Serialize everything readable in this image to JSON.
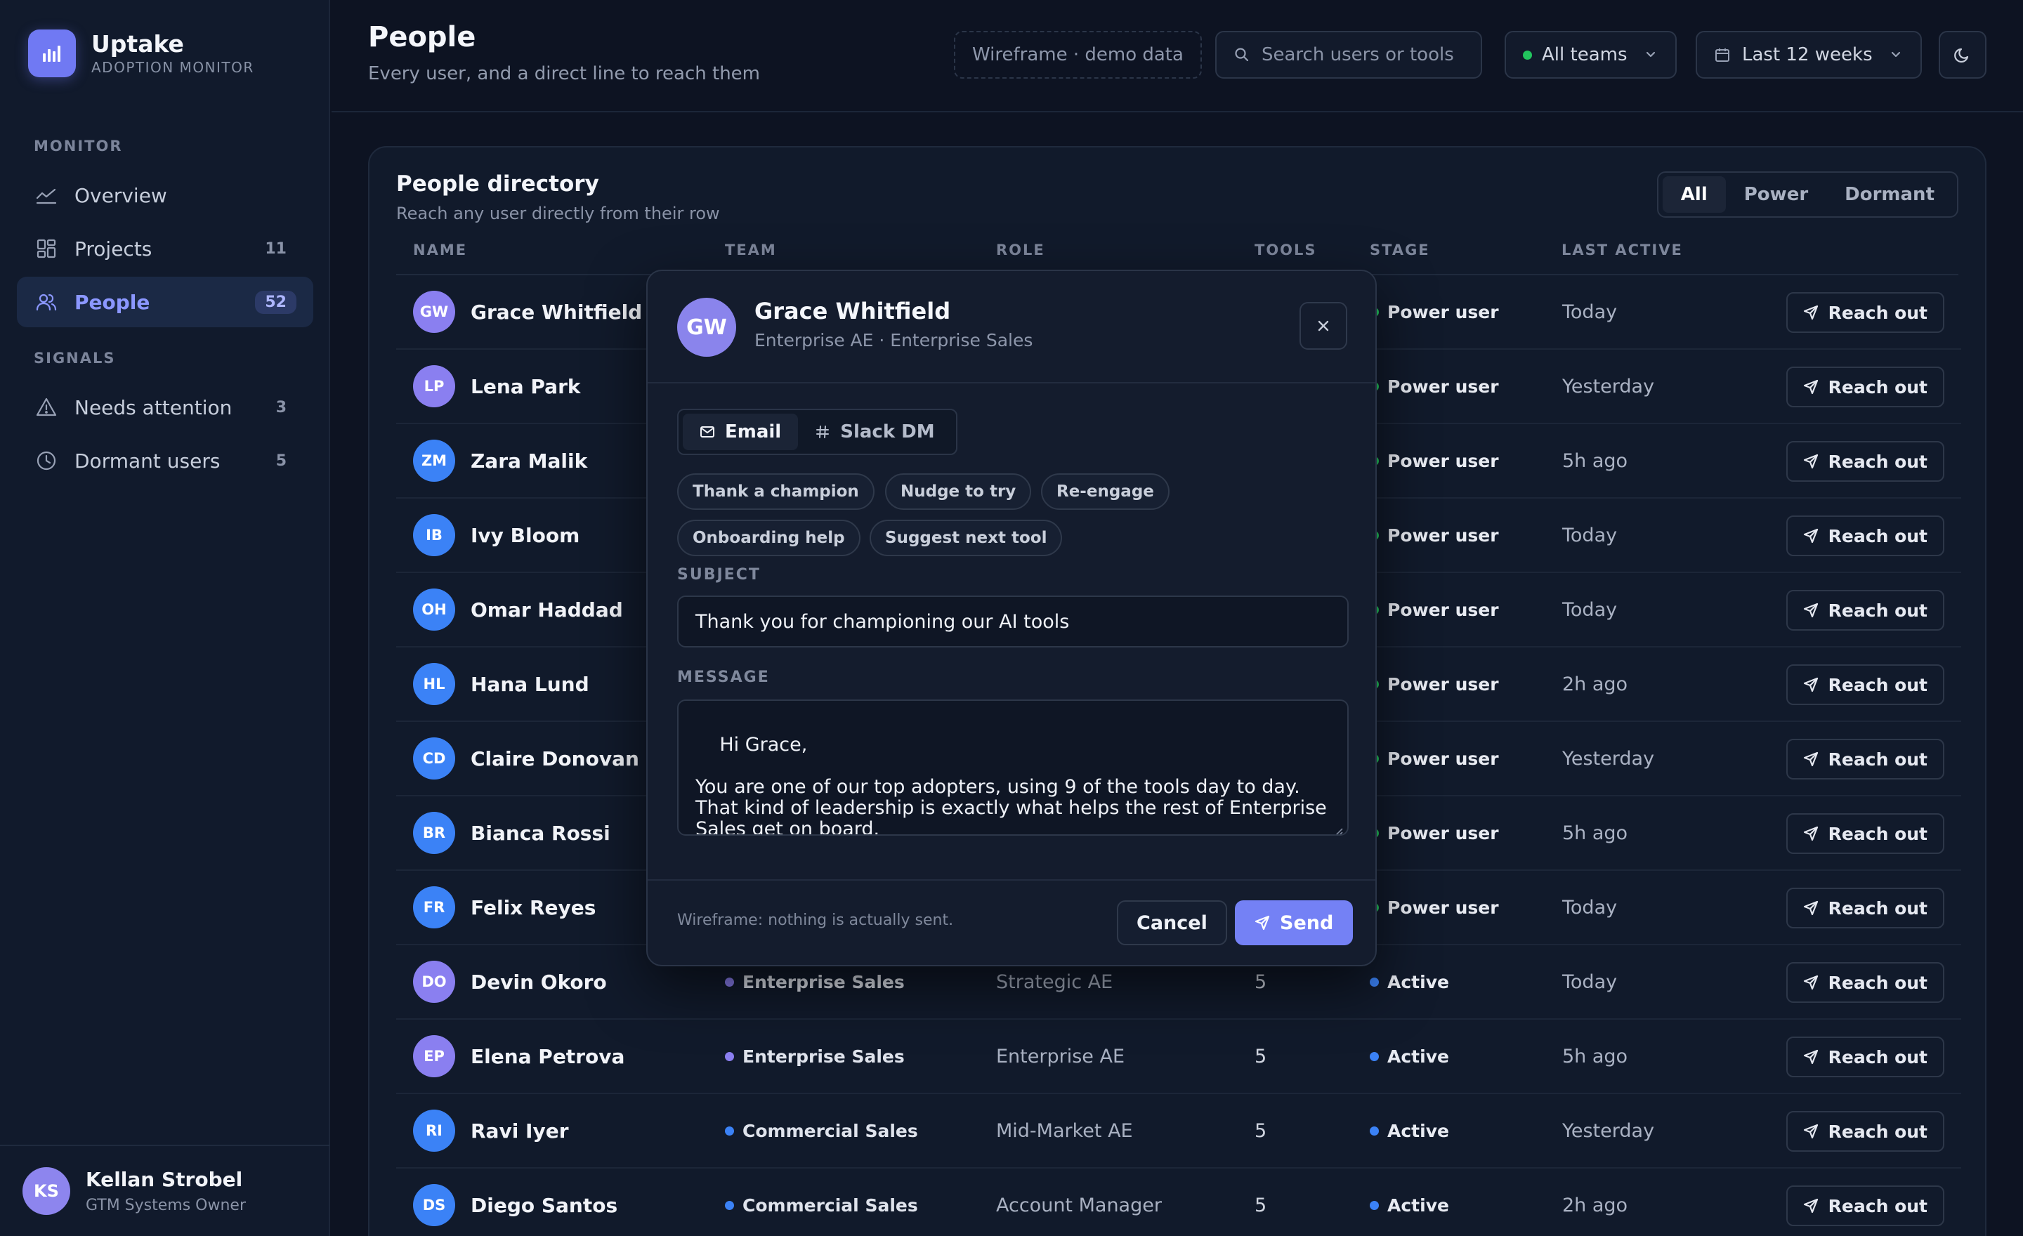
{
  "app": {
    "name": "Uptake",
    "subtitle": "ADOPTION MONITOR"
  },
  "sidebar": {
    "sections": [
      {
        "label": "MONITOR",
        "items": [
          {
            "label": "Overview",
            "icon": "trend-line-icon",
            "count": ""
          },
          {
            "label": "Projects",
            "icon": "dashboard-grid-icon",
            "count": "11"
          },
          {
            "label": "People",
            "icon": "users-icon",
            "count": "52",
            "active": true
          }
        ]
      },
      {
        "label": "SIGNALS",
        "items": [
          {
            "label": "Needs attention",
            "icon": "warning-triangle-icon",
            "count": "3"
          },
          {
            "label": "Dormant users",
            "icon": "clock-icon",
            "count": "5"
          }
        ]
      }
    ],
    "user": {
      "initials": "KS",
      "name": "Kellan Strobel",
      "role": "GTM Systems Owner"
    }
  },
  "header": {
    "title": "People",
    "subtitle": "Every user, and a direct line to reach them",
    "wireframe_badge": "Wireframe · demo data",
    "search_placeholder": "Search users or tools",
    "team_filter": "All teams",
    "date_filter": "Last 12 weeks"
  },
  "directory": {
    "title": "People directory",
    "subtitle": "Reach any user directly from their row",
    "filters": [
      "All",
      "Power",
      "Dormant"
    ],
    "active_filter": "All",
    "columns": [
      "NAME",
      "TEAM",
      "ROLE",
      "TOOLS",
      "STAGE",
      "LAST ACTIVE"
    ],
    "action_label": "Reach out",
    "rows": [
      {
        "initials": "GW",
        "name": "Grace Whitfield",
        "avatar_color": "#8a7ff0",
        "team": "",
        "team_color": "",
        "role": "",
        "tools": "",
        "stage": "Power user",
        "stage_color": "#22c55e",
        "last_active": "Today"
      },
      {
        "initials": "LP",
        "name": "Lena Park",
        "avatar_color": "#8a7ff0",
        "team": "",
        "team_color": "",
        "role": "",
        "tools": "",
        "stage": "Power user",
        "stage_color": "#22c55e",
        "last_active": "Yesterday"
      },
      {
        "initials": "ZM",
        "name": "Zara Malik",
        "avatar_color": "#3b82f6",
        "team": "",
        "team_color": "",
        "role": "",
        "tools": "",
        "stage": "Power user",
        "stage_color": "#22c55e",
        "last_active": "5h ago"
      },
      {
        "initials": "IB",
        "name": "Ivy Bloom",
        "avatar_color": "#3b82f6",
        "team": "",
        "team_color": "",
        "role": "",
        "tools": "",
        "stage": "Power user",
        "stage_color": "#22c55e",
        "last_active": "Today"
      },
      {
        "initials": "OH",
        "name": "Omar Haddad",
        "avatar_color": "#3b82f6",
        "team": "",
        "team_color": "",
        "role": "",
        "tools": "",
        "stage": "Power user",
        "stage_color": "#22c55e",
        "last_active": "Today"
      },
      {
        "initials": "HL",
        "name": "Hana Lund",
        "avatar_color": "#3b82f6",
        "team": "",
        "team_color": "",
        "role": "",
        "tools": "",
        "stage": "Power user",
        "stage_color": "#22c55e",
        "last_active": "2h ago"
      },
      {
        "initials": "CD",
        "name": "Claire Donovan",
        "avatar_color": "#3b82f6",
        "team": "",
        "team_color": "",
        "role": "",
        "tools": "",
        "stage": "Power user",
        "stage_color": "#22c55e",
        "last_active": "Yesterday"
      },
      {
        "initials": "BR",
        "name": "Bianca Rossi",
        "avatar_color": "#3b82f6",
        "team": "",
        "team_color": "",
        "role": "",
        "tools": "",
        "stage": "Power user",
        "stage_color": "#22c55e",
        "last_active": "5h ago"
      },
      {
        "initials": "FR",
        "name": "Felix Reyes",
        "avatar_color": "#3b82f6",
        "team": "",
        "team_color": "",
        "role": "",
        "tools": "",
        "stage": "Power user",
        "stage_color": "#22c55e",
        "last_active": "Today"
      },
      {
        "initials": "DO",
        "name": "Devin Okoro",
        "avatar_color": "#8a7ff0",
        "team": "Enterprise Sales",
        "team_color": "#8b7ff0",
        "role": "Strategic AE",
        "tools": "5",
        "stage": "Active",
        "stage_color": "#3b82f6",
        "last_active": "Today"
      },
      {
        "initials": "EP",
        "name": "Elena Petrova",
        "avatar_color": "#8a7ff0",
        "team": "Enterprise Sales",
        "team_color": "#8b7ff0",
        "role": "Enterprise AE",
        "tools": "5",
        "stage": "Active",
        "stage_color": "#3b82f6",
        "last_active": "5h ago"
      },
      {
        "initials": "RI",
        "name": "Ravi Iyer",
        "avatar_color": "#3b82f6",
        "team": "Commercial Sales",
        "team_color": "#3b82f6",
        "role": "Mid-Market AE",
        "tools": "5",
        "stage": "Active",
        "stage_color": "#3b82f6",
        "last_active": "Yesterday"
      },
      {
        "initials": "DS",
        "name": "Diego Santos",
        "avatar_color": "#3b82f6",
        "team": "Commercial Sales",
        "team_color": "#3b82f6",
        "role": "Account Manager",
        "tools": "5",
        "stage": "Active",
        "stage_color": "#3b82f6",
        "last_active": "2h ago"
      }
    ]
  },
  "modal": {
    "initials": "GW",
    "name": "Grace Whitfield",
    "meta": "Enterprise AE · Enterprise Sales",
    "channels": [
      "Email",
      "Slack DM"
    ],
    "active_channel": "Email",
    "templates": [
      "Thank a champion",
      "Nudge to try",
      "Re-engage",
      "Onboarding help",
      "Suggest next tool"
    ],
    "subject_label": "SUBJECT",
    "subject": "Thank you for championing our AI tools",
    "message_label": "MESSAGE",
    "message": "Hi Grace,\n\nYou are one of our top adopters, using 9 of the tools day to day. That kind of leadership is exactly what helps the rest of Enterprise Sales get on board.",
    "note": "Wireframe: nothing is actually sent.",
    "cancel_label": "Cancel",
    "send_label": "Send"
  },
  "colors": {
    "accent": "#7481f5",
    "background": "#0d1322",
    "panel": "#111a2b",
    "power": "#22c55e",
    "active": "#3b82f6",
    "team_online": "#22c55e"
  }
}
